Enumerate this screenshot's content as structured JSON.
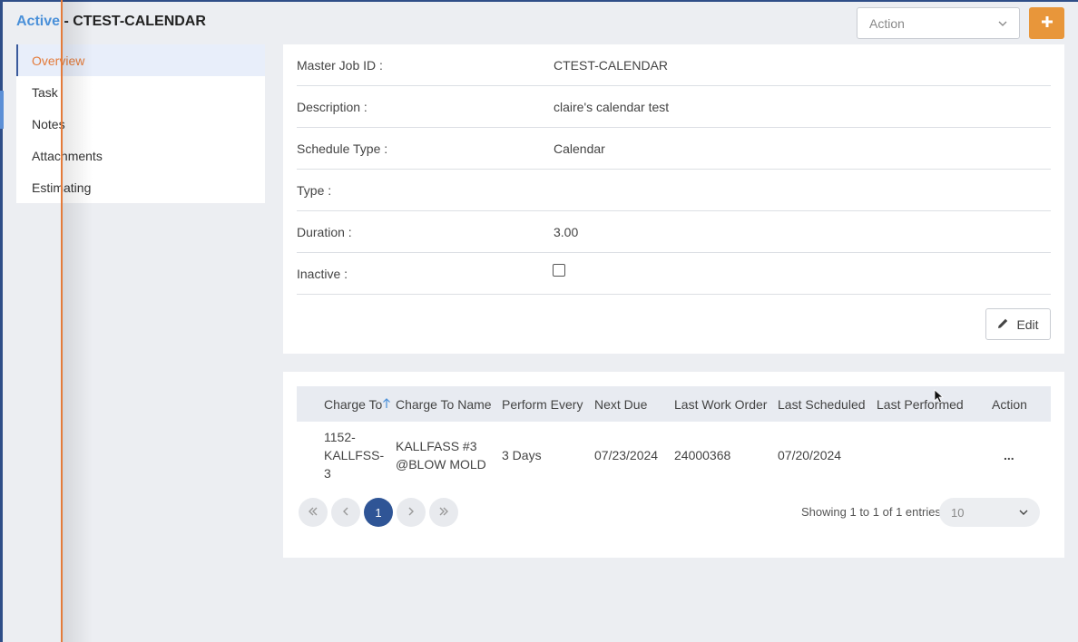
{
  "header": {
    "status": "Active",
    "separator": " - ",
    "job_code": "CTEST-CALENDAR",
    "action_placeholder": "Action",
    "add_icon": "plus-icon",
    "accent_color": "#e8963a"
  },
  "sidebar": {
    "items": [
      {
        "label": "Overview",
        "active": true
      },
      {
        "label": "Task"
      },
      {
        "label": "Notes"
      },
      {
        "label": "Attachments"
      },
      {
        "label": "Estimating"
      }
    ]
  },
  "details": {
    "rows": [
      {
        "label": "Master Job ID :",
        "value": "CTEST-CALENDAR"
      },
      {
        "label": "Description :",
        "value": "claire's calendar test"
      },
      {
        "label": "Schedule Type :",
        "value": "Calendar"
      },
      {
        "label": "Type :",
        "value": ""
      },
      {
        "label": "Duration :",
        "value": "3.00"
      },
      {
        "label": "Inactive :",
        "value": ""
      }
    ],
    "inactive_checked": false,
    "edit_label": "Edit",
    "edit_icon": "pencil-icon"
  },
  "table": {
    "columns": [
      "Charge To",
      "Charge To Name",
      "Perform Every",
      "Next Due",
      "Last Work Order",
      "Last Scheduled",
      "Last Performed",
      "Action"
    ],
    "sort_icon": "sort-up-arrow-icon",
    "rows": [
      {
        "charge_to_lines": [
          "1152-",
          "KALLFSS-",
          "3"
        ],
        "charge_to_name_lines": [
          "KALLFASS #3",
          "@BLOW MOLD"
        ],
        "perform_every": "3 Days",
        "next_due": "07/23/2024",
        "last_work_order": "24000368",
        "last_scheduled": "07/20/2024",
        "last_performed": "",
        "action": "..."
      }
    ]
  },
  "pagination": {
    "current_page": "1",
    "showing": "Showing 1 to 1 of 1 entries",
    "page_size": "10"
  }
}
